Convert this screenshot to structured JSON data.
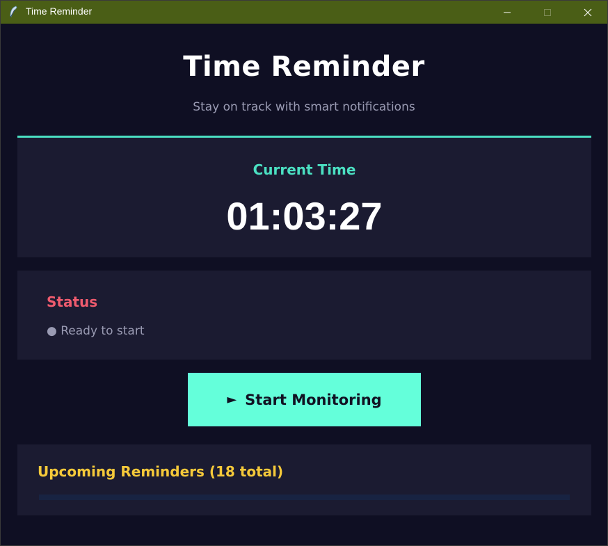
{
  "window": {
    "title": "Time Reminder",
    "icon": "feather-icon",
    "controls": {
      "minimize_icon": "minimize-icon",
      "maximize_icon": "maximize-icon",
      "close_icon": "close-icon"
    }
  },
  "header": {
    "title": "Time Reminder",
    "subtitle": "Stay on track with smart notifications"
  },
  "clock": {
    "label": "Current Time",
    "time": "01:03:27"
  },
  "status": {
    "title": "Status",
    "text": "● Ready to start"
  },
  "actions": {
    "start_icon": "►",
    "start_label": "Start Monitoring"
  },
  "reminders": {
    "title": "Upcoming Reminders (18 total)",
    "items": []
  },
  "colors": {
    "titlebar": "#4a5e16",
    "background": "#0f0f23",
    "card": "#1b1b31",
    "accent_teal": "#4be0c2",
    "button": "#64ffda",
    "status_red": "#ef5b6e",
    "reminders_yellow": "#f5c93a"
  }
}
